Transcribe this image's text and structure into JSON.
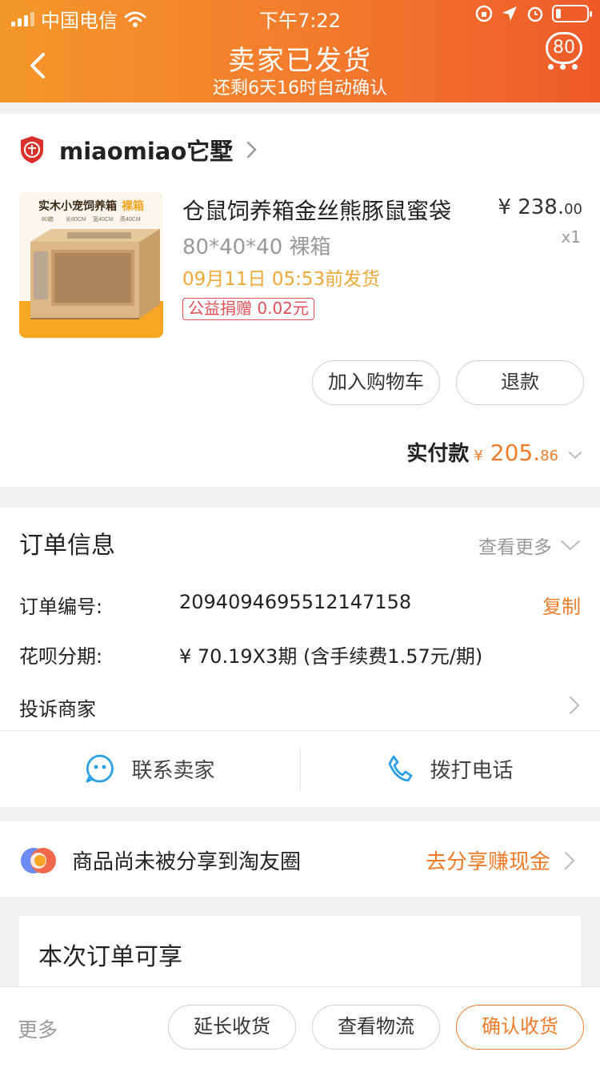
{
  "status_bar": {
    "carrier": "中国电信",
    "time": "下午7:22",
    "battery_level": 0.12
  },
  "header": {
    "title": "卖家已发货",
    "subtitle": "还剩6天16时自动确认",
    "message_count": "80",
    "gradient_colors": [
      "#f4972a",
      "#ee5a2a"
    ]
  },
  "shop": {
    "name": "miaomiao它墅",
    "icon": "shop-badge-icon"
  },
  "product": {
    "title": "仓鼠饲养箱金丝熊豚鼠蜜袋",
    "spec": "80*40*40 裸箱",
    "ship_time": "09月11日 05:53前发货",
    "charity_tag": "公益捐赠 0.02元",
    "price_main": "¥ 238.",
    "price_cents": "00",
    "quantity": "x1",
    "image_text": {
      "headline": "实木小宠饲养箱",
      "badge": "裸箱",
      "size_tags": [
        "80箱",
        "长80CM",
        "宽40CM",
        "高40CM"
      ]
    }
  },
  "actions": {
    "add_to_cart": "加入购物车",
    "refund": "退款"
  },
  "payment": {
    "label": "实付款",
    "currency": "¥",
    "amount_main": "205.",
    "amount_cents": "86"
  },
  "order_info": {
    "title": "订单信息",
    "more_label": "查看更多",
    "order_no_label": "订单编号:",
    "order_no": "2094094695512147158",
    "copy_label": "复制",
    "installment_label": "花呗分期:",
    "installment_value": "¥ 70.19X3期 (含手续费1.57元/期)",
    "complain_label": "投诉商家"
  },
  "contact": {
    "seller": "联系卖家",
    "phone": "拨打电话"
  },
  "share": {
    "text": "商品尚未被分享到淘友圈",
    "action": "去分享赚现金"
  },
  "benefit": {
    "title": "本次订单可享"
  },
  "bottom_bar": {
    "more": "更多",
    "extend": "延长收货",
    "logistics": "查看物流",
    "confirm": "确认收货"
  },
  "colors": {
    "accent": "#f07c2a",
    "ship_time": "#f0a83a",
    "charity": "#e0505a",
    "contact_icon": "#2aa0e6"
  }
}
